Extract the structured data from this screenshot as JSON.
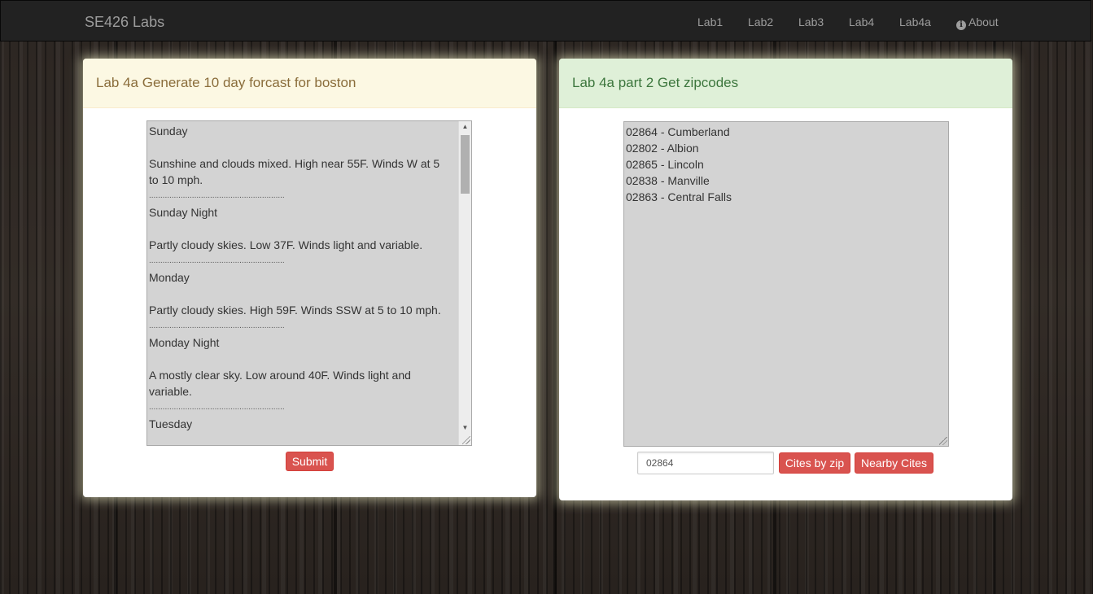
{
  "navbar": {
    "brand": "SE426 Labs",
    "links": [
      "Lab1",
      "Lab2",
      "Lab3",
      "Lab4",
      "Lab4a"
    ],
    "about": "About"
  },
  "forecast_panel": {
    "title": "Lab 4a Generate 10 day forcast for boston",
    "lines": [
      "Sunday",
      "",
      "Sunshine and clouds mixed. High near 55F. Winds W at 5",
      "to 10 mph.",
      "............................................................",
      "Sunday Night",
      "",
      "Partly cloudy skies. Low 37F. Winds light and variable.",
      "............................................................",
      "Monday",
      "",
      "Partly cloudy skies. High 59F. Winds SSW at 5 to 10 mph.",
      "............................................................",
      "Monday Night",
      "",
      "A mostly clear sky. Low around 40F. Winds light and",
      "variable.",
      "............................................................",
      "Tuesday"
    ],
    "submit_label": "Submit"
  },
  "zip_panel": {
    "title": "Lab 4a part 2 Get zipcodes",
    "results": [
      "02864 - Cumberland",
      "02802 - Albion",
      "02865 - Lincoln",
      "02838 - Manville",
      "02863 - Central Falls"
    ],
    "zip_value": "02864",
    "cities_button": "Cites by zip",
    "nearby_button": "Nearby Cites"
  }
}
